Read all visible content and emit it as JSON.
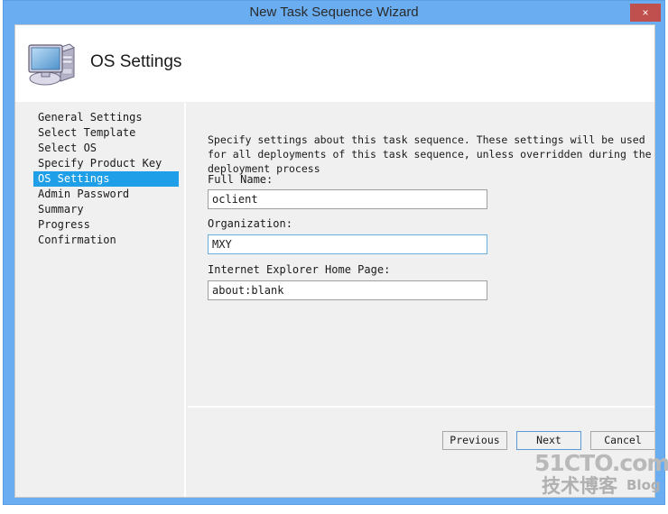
{
  "window": {
    "title": "New Task Sequence Wizard",
    "close_label": "×",
    "titlebar_color": "#6aadf0",
    "close_button_color": "#c0504d"
  },
  "header": {
    "page_title": "OS Settings",
    "icon": "computer-icon"
  },
  "sidebar": {
    "items": [
      {
        "label": "General Settings",
        "active": false
      },
      {
        "label": "Select Template",
        "active": false
      },
      {
        "label": "Select OS",
        "active": false
      },
      {
        "label": "Specify Product Key",
        "active": false
      },
      {
        "label": "OS Settings",
        "active": true
      },
      {
        "label": "Admin Password",
        "active": false
      },
      {
        "label": "Summary",
        "active": false
      },
      {
        "label": "Progress",
        "active": false
      },
      {
        "label": "Confirmation",
        "active": false
      }
    ],
    "active_highlight_color": "#1e9fe8"
  },
  "main": {
    "description": "Specify settings about this task sequence.  These settings will be used for all deployments of this task sequence, unless overridden during the deployment process",
    "fields": [
      {
        "label": "Full Name:",
        "value": "oclient",
        "focused": false
      },
      {
        "label": "Organization:",
        "value": "MXY",
        "focused": true
      },
      {
        "label": "Internet Explorer Home Page:",
        "value": "about:blank",
        "focused": false
      }
    ]
  },
  "footer": {
    "previous_label": "Previous",
    "next_label": "Next",
    "cancel_label": "Cancel"
  },
  "watermark": {
    "line1": "51CTO.com",
    "line2": "技术博客",
    "line3": "Blog"
  }
}
